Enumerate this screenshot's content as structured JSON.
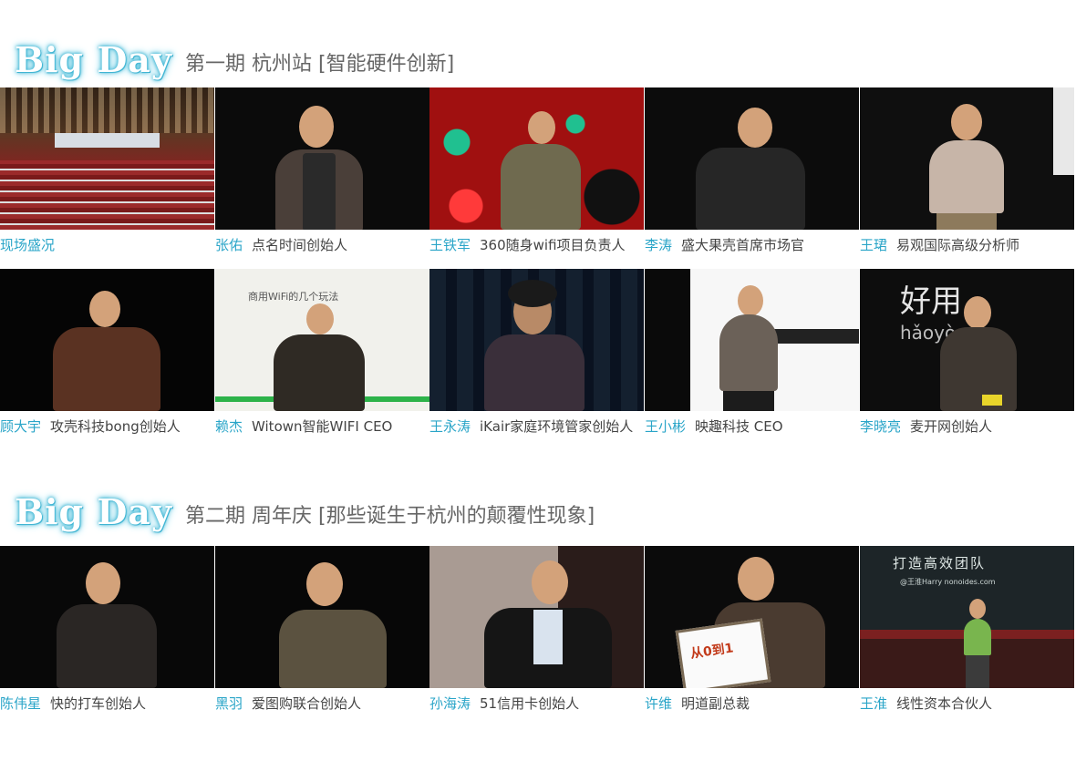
{
  "sections": [
    {
      "logo": "Big Day",
      "subtitle": "第一期 杭州站 [智能硬件创新]",
      "rows": [
        [
          {
            "name": "现场盛况",
            "role": ""
          },
          {
            "name": "张佑",
            "role": "点名时间创始人"
          },
          {
            "name": "王铁军",
            "role": "360随身wifi项目负责人"
          },
          {
            "name": "李涛",
            "role": "盛大果壳首席市场官"
          },
          {
            "name": "王珺",
            "role": "易观国际高级分析师"
          }
        ],
        [
          {
            "name": "顾大宇",
            "role": "攻壳科技bong创始人"
          },
          {
            "name": "赖杰",
            "role": "Witown智能WIFI CEO"
          },
          {
            "name": "王永涛",
            "role": "iKair家庭环境管家创始人"
          },
          {
            "name": "王小彬",
            "role": "映趣科技 CEO"
          },
          {
            "name": "李晓亮",
            "role": "麦开网创始人"
          }
        ]
      ]
    },
    {
      "logo": "Big Day",
      "subtitle": "第二期 周年庆  [那些诞生于杭州的颠覆性现象]",
      "rows": [
        [
          {
            "name": "陈伟星",
            "role": "快的打车创始人"
          },
          {
            "name": "黑羽",
            "role": "爱图购联合创始人"
          },
          {
            "name": "孙海涛",
            "role": "51信用卡创始人"
          },
          {
            "name": "许维",
            "role": "明道副总裁"
          },
          {
            "name": "王淮",
            "role": "线性资本合伙人"
          }
        ]
      ]
    }
  ],
  "slide_text": {
    "wifi_slide": "商用WiFi的几个玩法",
    "good_use": "好用",
    "pinyin": "hǎoyò",
    "team_slide": "打造高效团队",
    "team_sub": "@王淮Harry nonoides.com",
    "book_title": "从0到1"
  },
  "colors": {
    "accent": "#2aa5c8",
    "role_text": "#444444",
    "subtitle_text": "#666666"
  }
}
